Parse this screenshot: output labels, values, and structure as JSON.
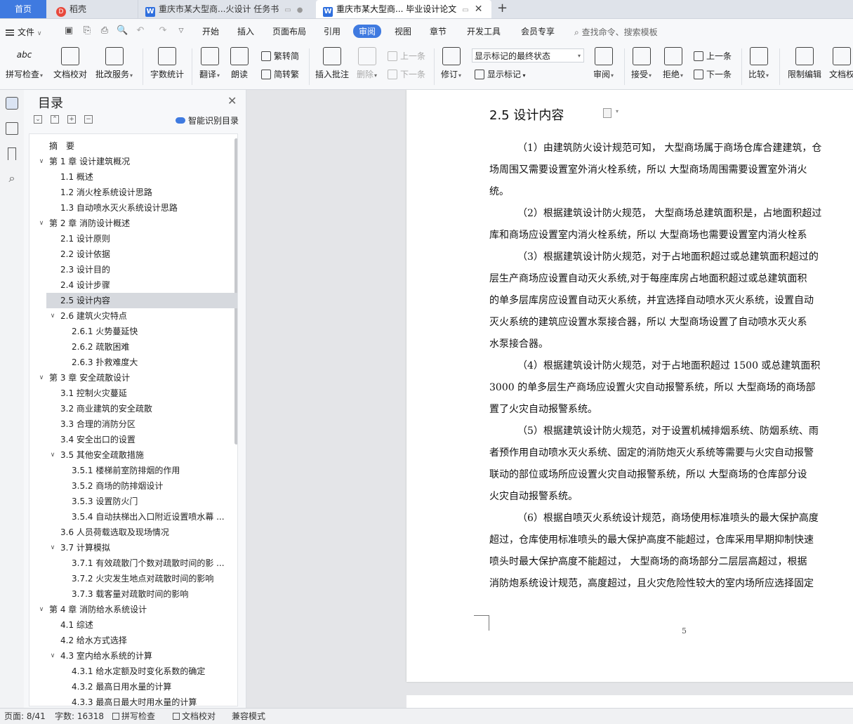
{
  "tabs": {
    "home": "首页",
    "daoke": "稻壳",
    "doc1": "重庆市某大型商...火设计 任务书",
    "doc2": "重庆市某大型商... 毕业设计论文"
  },
  "menu": {
    "file": "文件",
    "tabs": [
      "开始",
      "插入",
      "页面布局",
      "引用",
      "审阅",
      "视图",
      "章节",
      "开发工具",
      "会员专享"
    ],
    "active_tab": "审阅",
    "search": "查找命令、搜索模板"
  },
  "ribbon": {
    "spell": "拼写检查",
    "doccheck": "文档校对",
    "batch": "批改服务",
    "wordcount": "字数统计",
    "translate": "翻译",
    "read": "朗读",
    "to_trad": "繁转简",
    "to_simp": "简转繁",
    "insert_comment": "插入批注",
    "delete": "删除",
    "prev_comment": "上一条",
    "next_comment": "下一条",
    "revise": "修订",
    "markup_state": "显示标记的最终状态",
    "show_markup": "显示标记",
    "review": "审阅",
    "accept": "接受",
    "reject": "拒绝",
    "prev": "上一条",
    "next": "下一条",
    "compare": "比较",
    "restrict": "限制编辑",
    "docpower": "文档权"
  },
  "toc": {
    "title": "目录",
    "smart": "智能识别目录",
    "items": [
      {
        "text": "摘　要",
        "level": 0,
        "arrow": ""
      },
      {
        "text": "第 1 章  设计建筑概况",
        "level": 0,
        "arrow": "v"
      },
      {
        "text": "1.1 概述",
        "level": 1,
        "arrow": ""
      },
      {
        "text": "1.2 消火栓系统设计思路",
        "level": 1,
        "arrow": ""
      },
      {
        "text": "1.3 自动喷水灭火系统设计思路",
        "level": 1,
        "arrow": ""
      },
      {
        "text": "第 2 章  消防设计概述",
        "level": 0,
        "arrow": "v"
      },
      {
        "text": "2.1 设计原则",
        "level": 1,
        "arrow": ""
      },
      {
        "text": "2.2  设计依据",
        "level": 1,
        "arrow": ""
      },
      {
        "text": "2.3  设计目的",
        "level": 1,
        "arrow": ""
      },
      {
        "text": "2.4  设计步骤",
        "level": 1,
        "arrow": ""
      },
      {
        "text": "2.5  设计内容",
        "level": 1,
        "arrow": "",
        "selected": true
      },
      {
        "text": "2.6  建筑火灾特点",
        "level": 1,
        "arrow": "v"
      },
      {
        "text": "2.6.1 火势蔓延快",
        "level": 2,
        "arrow": ""
      },
      {
        "text": "2.6.2  疏散困难",
        "level": 2,
        "arrow": ""
      },
      {
        "text": "2.6.3  扑救难度大",
        "level": 2,
        "arrow": ""
      },
      {
        "text": "第 3 章  安全疏散设计",
        "level": 0,
        "arrow": "v"
      },
      {
        "text": "3.1 控制火灾蔓延",
        "level": 1,
        "arrow": ""
      },
      {
        "text": "3.2 商业建筑的安全疏散",
        "level": 1,
        "arrow": ""
      },
      {
        "text": "3.3 合理的消防分区",
        "level": 1,
        "arrow": ""
      },
      {
        "text": "3.4 安全出口的设置",
        "level": 1,
        "arrow": ""
      },
      {
        "text": "3.5 其他安全疏散措施",
        "level": 1,
        "arrow": "v"
      },
      {
        "text": "3.5.1 楼梯前室防排烟的作用",
        "level": 2,
        "arrow": ""
      },
      {
        "text": "3.5.2 商场的防排烟设计",
        "level": 2,
        "arrow": ""
      },
      {
        "text": "3.5.3 设置防火门",
        "level": 2,
        "arrow": ""
      },
      {
        "text": "3.5.4 自动扶梯出入口附近设置喷水幕 ...",
        "level": 2,
        "arrow": ""
      },
      {
        "text": "3.6  人员荷载选取及现场情况",
        "level": 1,
        "arrow": ""
      },
      {
        "text": "3.7  计算模拟",
        "level": 1,
        "arrow": "v"
      },
      {
        "text": "3.7.1  有效疏散门个数对疏散时间的影 ...",
        "level": 2,
        "arrow": ""
      },
      {
        "text": "3.7.2  火灾发生地点对疏散时间的影响",
        "level": 2,
        "arrow": ""
      },
      {
        "text": "3.7.3  载客量对疏散时间的影响",
        "level": 2,
        "arrow": ""
      },
      {
        "text": "第 4 章  消防给水系统设计",
        "level": 0,
        "arrow": "v"
      },
      {
        "text": "4.1  综述",
        "level": 1,
        "arrow": ""
      },
      {
        "text": "4.2  给水方式选择",
        "level": 1,
        "arrow": ""
      },
      {
        "text": "4.3  室内给水系统的计算",
        "level": 1,
        "arrow": "v"
      },
      {
        "text": "4.3.1 给水定额及时变化系数的确定",
        "level": 2,
        "arrow": ""
      },
      {
        "text": "4.3.2 最高日用水量的计算",
        "level": 2,
        "arrow": ""
      },
      {
        "text": "4.3.3  最高日最大时用水量的计算",
        "level": 2,
        "arrow": ""
      }
    ]
  },
  "document": {
    "heading": "2.5  设计内容",
    "lines": [
      {
        "text": "（1）由建筑防火设计规范可知， 大型商场属于商场仓库合建建筑，仓",
        "indent": true
      },
      {
        "text": "场周围又需要设置室外消火栓系统，所以 大型商场周围需要设置室外消火",
        "indent": false
      },
      {
        "text": "统。",
        "indent": false
      },
      {
        "text": "（2）根据建筑设计防火规范， 大型商场总建筑面积是，占地面积超过",
        "indent": true
      },
      {
        "text": "库和商场应设置室内消火栓系统，所以 大型商场也需要设置室内消火栓系",
        "indent": false
      },
      {
        "text": "（3）根据建筑设计防火规范，对于占地面积超过或总建筑面积超过的",
        "indent": true
      },
      {
        "text": "层生产商场应设置自动灭火系统,对于每座库房占地面积超过或总建筑面积",
        "indent": false
      },
      {
        "text": "的单多层库房应设置自动灭火系统，并宜选择自动喷水灭火系统，设置自动",
        "indent": false
      },
      {
        "text": "灭火系统的建筑应设置水泵接合器，所以 大型商场设置了自动喷水灭火系",
        "indent": false
      },
      {
        "text": "水泵接合器。",
        "indent": false
      },
      {
        "text": "（4）根据建筑设计防火规范，对于占地面积超过 1500 或总建筑面积",
        "indent": true
      },
      {
        "text": "3000 的单多层生产商场应设置火灾自动报警系统，所以 大型商场的商场部",
        "indent": false
      },
      {
        "text": "置了火灾自动报警系统。",
        "indent": false
      },
      {
        "text": "（5）根据建筑设计防火规范，对于设置机械排烟系统、防烟系统、雨",
        "indent": true
      },
      {
        "text": "者预作用自动喷水灭火系统、固定的消防炮灭火系统等需要与火灾自动报警",
        "indent": false
      },
      {
        "text": "联动的部位或场所应设置火灾自动报警系统，所以 大型商场的仓库部分设",
        "indent": false
      },
      {
        "text": "火灾自动报警系统。",
        "indent": false
      },
      {
        "text": "（6）根据自喷灭火系统设计规范，商场使用标准喷头的最大保护高度",
        "indent": true
      },
      {
        "text": "超过，仓库使用标准喷头的最大保护高度不能超过，仓库采用早期抑制快速",
        "indent": false
      },
      {
        "text": "喷头时最大保护高度不能超过， 大型商场的商场部分二层层高超过，根据",
        "indent": false
      },
      {
        "text": "消防炮系统设计规范，高度超过，且火灾危险性较大的室内场所应选择固定",
        "indent": false
      }
    ],
    "page_number": "5"
  },
  "status": {
    "page": "页面: 8/41",
    "words": "字数: 16318",
    "spell": "拼写检查",
    "doccheck": "文档校对",
    "compat": "兼容模式"
  }
}
